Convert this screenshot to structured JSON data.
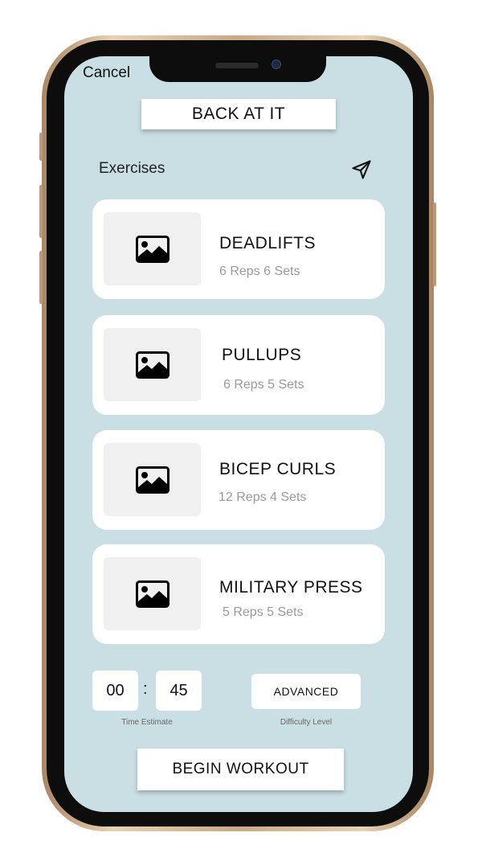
{
  "header": {
    "cancel_label": "Cancel",
    "workout_title": "BACK AT IT"
  },
  "section": {
    "label": "Exercises",
    "share_icon": "send-icon"
  },
  "exercises": [
    {
      "name": "DEADLIFTS",
      "detail": "6 Reps 6 Sets",
      "icon": "image-placeholder-icon"
    },
    {
      "name": "PULLUPS",
      "detail": "6 Reps 5 Sets",
      "icon": "image-placeholder-icon"
    },
    {
      "name": "BICEP CURLS",
      "detail": "12 Reps 4 Sets",
      "icon": "image-placeholder-icon"
    },
    {
      "name": "MILITARY PRESS",
      "detail": "5 Reps 5 Sets",
      "icon": "image-placeholder-icon"
    }
  ],
  "time_estimate": {
    "hours": "00",
    "separator": ":",
    "minutes": "45",
    "caption": "Time Estimate"
  },
  "difficulty": {
    "value": "ADVANCED",
    "caption": "Difficulty Level"
  },
  "actions": {
    "begin_label": "BEGIN WORKOUT"
  },
  "colors": {
    "screen_background": "#c9dfe3",
    "card_background": "#ffffff",
    "thumbnail_background": "#f0f0f0",
    "phone_frame": "#c9a985"
  }
}
